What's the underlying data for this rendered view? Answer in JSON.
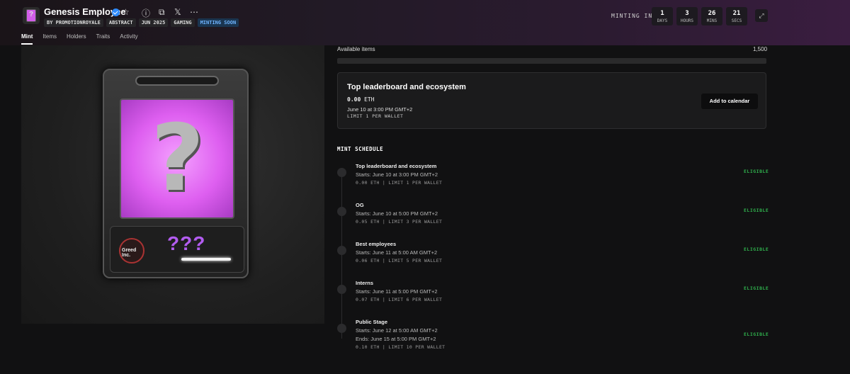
{
  "header": {
    "title": "Genesis Employee",
    "tags": [
      "BY PROMOTIONROYALE",
      "ABSTRACT",
      "JUN 2025",
      "GAMING",
      "MINTING SOON"
    ],
    "countdown_label": "MINTING IN",
    "countdown": [
      {
        "value": "1",
        "unit": "DAYS"
      },
      {
        "value": "3",
        "unit": "HOURS"
      },
      {
        "value": "26",
        "unit": "MINS"
      },
      {
        "value": "21",
        "unit": "SECS"
      }
    ]
  },
  "tabs": [
    "Mint",
    "Items",
    "Holders",
    "Traits",
    "Activity"
  ],
  "artwork": {
    "card_question": "?",
    "card_caption": "???",
    "badge_text": "Greed Inc."
  },
  "available": {
    "label": "Available items",
    "value": "1,500"
  },
  "current_stage": {
    "title": "Top leaderboard and ecosystem",
    "price": "0.00",
    "currency": "ETH",
    "date": "June 10 at 3:00 PM GMT+2",
    "limit": "LIMIT 1 PER WALLET",
    "button": "Add to calendar"
  },
  "schedule": {
    "title": "MINT SCHEDULE",
    "stages": [
      {
        "name": "Top leaderboard and ecosystem",
        "starts": "Starts: June 10 at 3:00 PM GMT+2",
        "meta": "0.00 ETH | LIMIT 1 PER WALLET",
        "status": "ELIGIBLE"
      },
      {
        "name": "OG",
        "starts": "Starts: June 10 at 5:00 PM GMT+2",
        "meta": "0.05 ETH | LIMIT 3 PER WALLET",
        "status": "ELIGIBLE"
      },
      {
        "name": "Best employees",
        "starts": "Starts: June 11 at 5:00 AM GMT+2",
        "meta": "0.06 ETH | LIMIT 5 PER WALLET",
        "status": "ELIGIBLE"
      },
      {
        "name": "Interns",
        "starts": "Starts: June 11 at 5:00 PM GMT+2",
        "meta": "0.07 ETH | LIMIT 6 PER WALLET",
        "status": "ELIGIBLE"
      },
      {
        "name": "Public Stage",
        "starts": "Starts: June 12 at 5:00 AM GMT+2",
        "ends": "Ends: June 15 at 5:00 PM GMT+2",
        "meta": "0.10 ETH | LIMIT 10 PER WALLET",
        "status": "ELIGIBLE"
      }
    ]
  }
}
